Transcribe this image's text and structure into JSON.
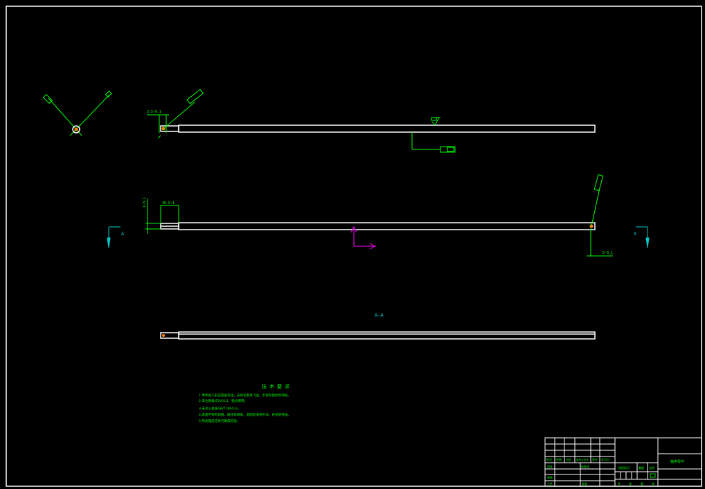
{
  "drawing": {
    "background": "#000000",
    "colors": {
      "outline": "#ffffff",
      "annotation": "#00ff00",
      "section": "#00c8c8",
      "ucs": "#d000d0",
      "point": "#ff8000"
    },
    "dimensions": {
      "top_left": "3.5-0.1",
      "mid_top": "30-0.1",
      "mid_left": "1-0.1",
      "mid_right": "5-0.1"
    },
    "section_marks": {
      "left": "A",
      "right": "A",
      "view_label": "A—A"
    },
    "tech_requirements": {
      "title": "技术要求",
      "lines": [
        "1.零件加工前应检查毛坯，去除毛刺及飞边，不得有裂纹等缺陷。",
        "2.未注倒角均为C0.5，锐边倒钝。",
        "3.未注公差按GB/T1804-m。",
        "4.表面不得有划痕、碰伤等缺陷，装配前清洗干净，并涂防锈油。",
        "5.热处理后应进行硬度检验。"
      ]
    },
    "title_block": {
      "drawing_name": "轴类零件",
      "row_labels": [
        "标记",
        "处数",
        "分区",
        "更改文件号",
        "签名",
        "年月日"
      ],
      "left_labels": [
        "设计",
        "审核",
        "工艺",
        "标准化",
        "批准"
      ],
      "mid_labels": [
        "阶段标记",
        "重量",
        "比例"
      ],
      "sheet_labels": [
        "共",
        "张",
        "第",
        "张"
      ]
    }
  }
}
